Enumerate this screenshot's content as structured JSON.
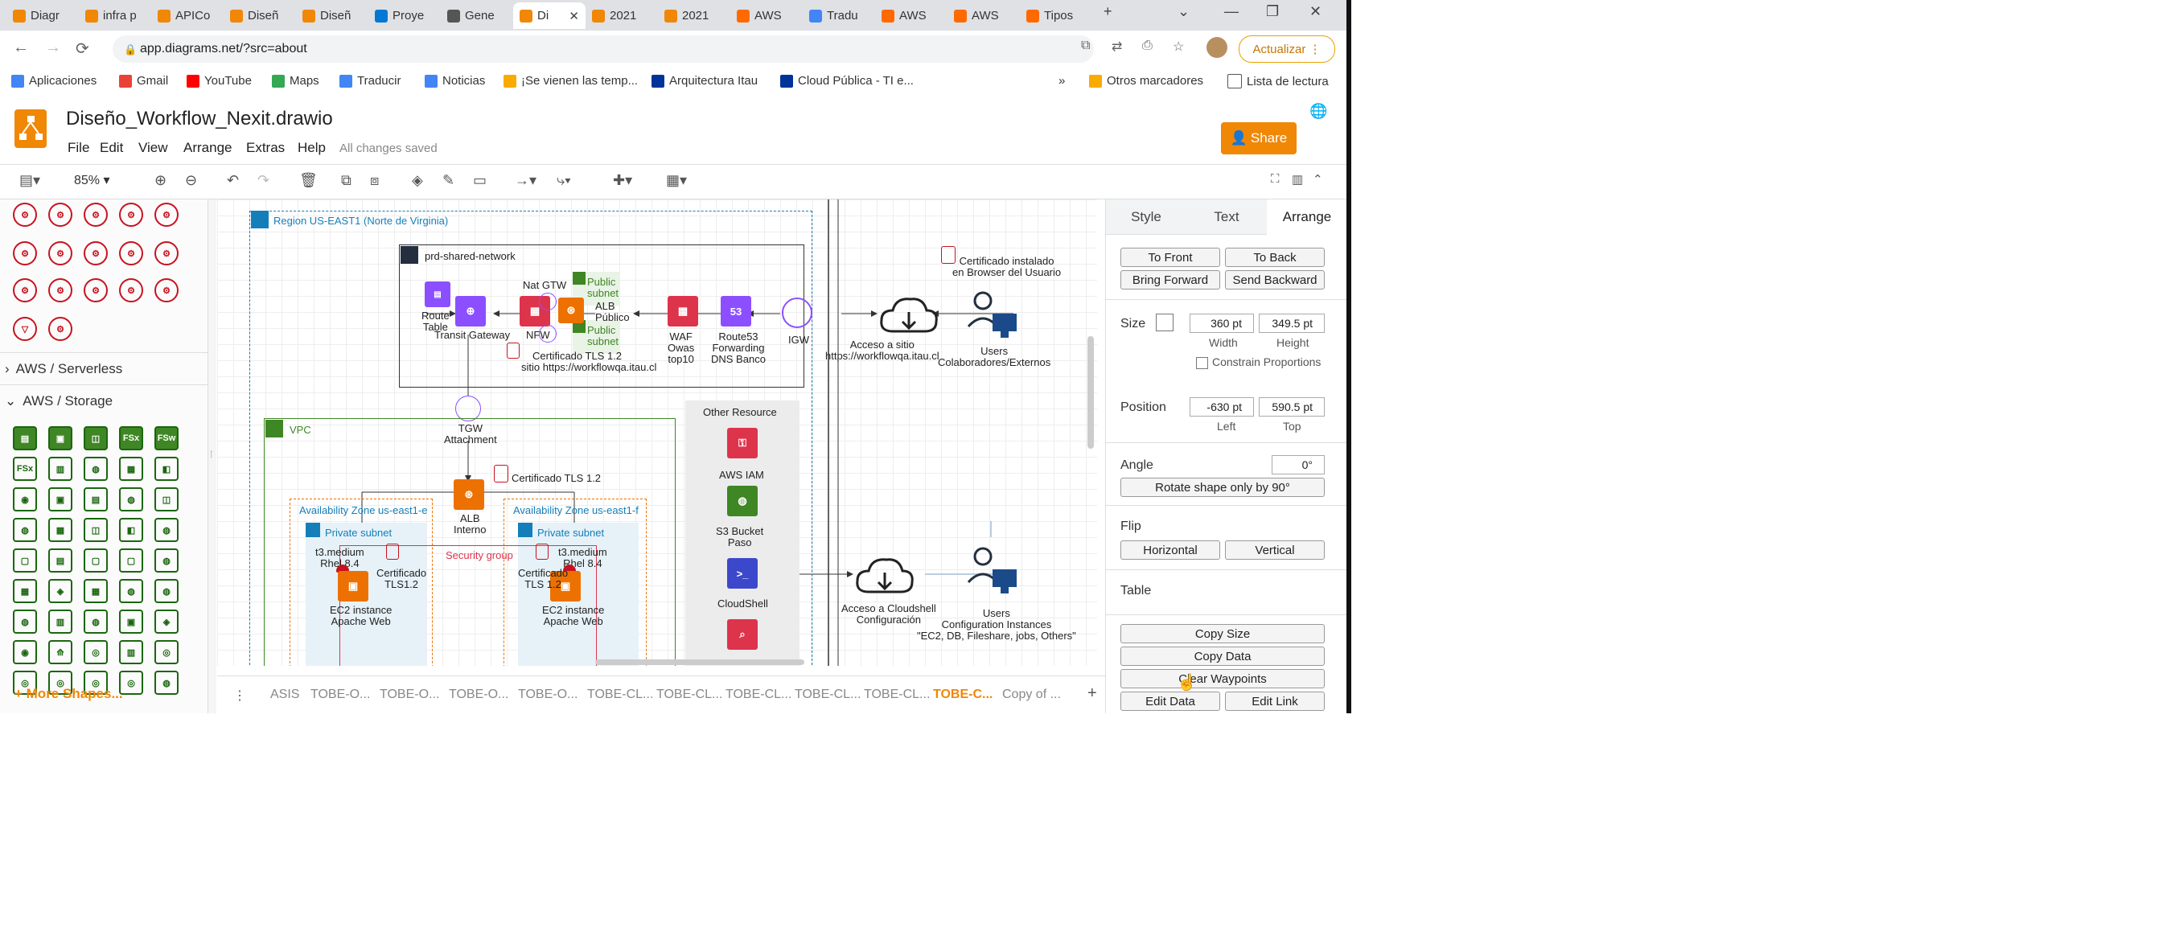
{
  "browser": {
    "tabs": [
      {
        "label": "Diagr",
        "color": "#f08705"
      },
      {
        "label": "infra p",
        "color": "#f08705"
      },
      {
        "label": "APICo",
        "color": "#f08705"
      },
      {
        "label": "Diseñ",
        "color": "#f08705"
      },
      {
        "label": "Diseñ",
        "color": "#f08705"
      },
      {
        "label": "Proye",
        "color": "#0078d4"
      },
      {
        "label": "Gene",
        "color": "#555555"
      },
      {
        "label": "Di",
        "color": "#f08705"
      },
      {
        "label": "2021",
        "color": "#f08705"
      },
      {
        "label": "2021",
        "color": "#f08705"
      },
      {
        "label": "AWS",
        "color": "#ff6a00"
      },
      {
        "label": "Tradu",
        "color": "#4285f4"
      },
      {
        "label": "AWS",
        "color": "#ff6a00"
      },
      {
        "label": "AWS",
        "color": "#ff6a00"
      },
      {
        "label": "Tipos",
        "color": "#ff6a00"
      }
    ],
    "url": "app.diagrams.net/?src=about",
    "update_label": "Actualizar",
    "bookmarks": [
      "Aplicaciones",
      "Gmail",
      "YouTube",
      "Maps",
      "Traducir",
      "Noticias",
      "¡Se vienen las temp...",
      "Arquitectura Itau",
      "Cloud Pública - TI e..."
    ],
    "bookmarks_right": [
      "Otros marcadores",
      "Lista de lectura"
    ]
  },
  "drawio": {
    "title": "Diseño_Workflow_Nexit.drawio",
    "menu": [
      "File",
      "Edit",
      "View",
      "Arrange",
      "Extras",
      "Help"
    ],
    "saved_status": "All changes saved",
    "share_label": "Share",
    "zoom": "85%"
  },
  "shapes_panel": {
    "sections": [
      "AWS / Serverless",
      "AWS / Storage"
    ],
    "more_shapes": "+ More Shapes..."
  },
  "diagram": {
    "region": "Region US-EAST1 (Norte de Virginia)",
    "shared_network": "prd-shared-network",
    "route_table": "Route\nTable",
    "transit_gateway": "Transit Gateway",
    "nfw": "NFW",
    "nat_gw": "Nat GTW",
    "public_subnet_1": "Public\nsubnet",
    "public_subnet_2": "Public\nsubnet",
    "alb_public": "ALB\nPúblico",
    "cert_tls_12_a": "Certificado TLS 1.2",
    "site_url": "sitio https://workflowqa.itau.cl",
    "waf": "WAF\nOwas\ntop10",
    "route53": "Route53\nForwarding\nDNS Banco",
    "igw": "IGW",
    "cert_browser": "Certificado instalado\nen Browser del Usuario",
    "access_site": "Acceso a sitio\nhttps://workflowqa.itau.cl",
    "users_ext": "Users\nColaboradores/Externos",
    "tgw_attachment": "TGW\nAttachment",
    "vpc": "VPC",
    "cert_tls_12_b": "Certificado TLS 1.2",
    "alb_internal": "ALB\nInterno",
    "az_e": "Availability Zone us-east1-e",
    "az_f": "Availability Zone us-east1-f",
    "private_subnet_1": "Private subnet",
    "private_subnet_2": "Private subnet",
    "security_group": "Security group",
    "t3_e": "t3.medium\nRhel 8.4",
    "t3_f": "t3.medium\nRhel 8.4",
    "cert_tls_e": "Certificado\nTLS1.2",
    "cert_tls_f": "Certificado\nTLS 1.2",
    "ec2_e": "EC2 instance\nApache Web",
    "ec2_f": "EC2 instance\nApache Web",
    "other_resource": "Other Resource",
    "aws_iam": "AWS IAM",
    "s3": "S3 Bucket\nPaso",
    "cloudshell": "CloudShell",
    "access_cloudshell": "Acceso a Cloudshell\nConfiguración",
    "users_config": "Users\nConfiguration Instances\n\"EC2, DB, Fileshare, jobs, Others\""
  },
  "page_tabs": [
    "ASIS",
    "TOBE-O...",
    "TOBE-O...",
    "TOBE-O...",
    "TOBE-O...",
    "TOBE-CL...",
    "TOBE-CL...",
    "TOBE-CL...",
    "TOBE-CL...",
    "TOBE-CL...",
    "TOBE-C...",
    "Copy of ..."
  ],
  "active_page_index": 10,
  "format_panel": {
    "tabs": [
      "Style",
      "Text",
      "Arrange"
    ],
    "to_front": "To Front",
    "to_back": "To Back",
    "bring_forward": "Bring Forward",
    "send_backward": "Send Backward",
    "size_label": "Size",
    "width_value": "360 pt",
    "height_value": "349.5 pt",
    "width_label": "Width",
    "height_label": "Height",
    "constrain": "Constrain Proportions",
    "position_label": "Position",
    "left_value": "-630 pt",
    "top_value": "590.5 pt",
    "left_label": "Left",
    "top_label": "Top",
    "angle_label": "Angle",
    "angle_value": "0°",
    "rotate": "Rotate shape only by 90°",
    "flip_label": "Flip",
    "horizontal": "Horizontal",
    "vertical": "Vertical",
    "table_label": "Table",
    "copy_size": "Copy Size",
    "copy_data": "Copy Data",
    "clear_waypoints": "Clear Waypoints",
    "edit_data": "Edit Data",
    "edit_link": "Edit Link"
  },
  "colors": {
    "accent": "#f08705",
    "aws_green": "#3f8624",
    "aws_red": "#dd344c",
    "aws_purple": "#8c4fff",
    "aws_blue": "#3b48cc"
  }
}
